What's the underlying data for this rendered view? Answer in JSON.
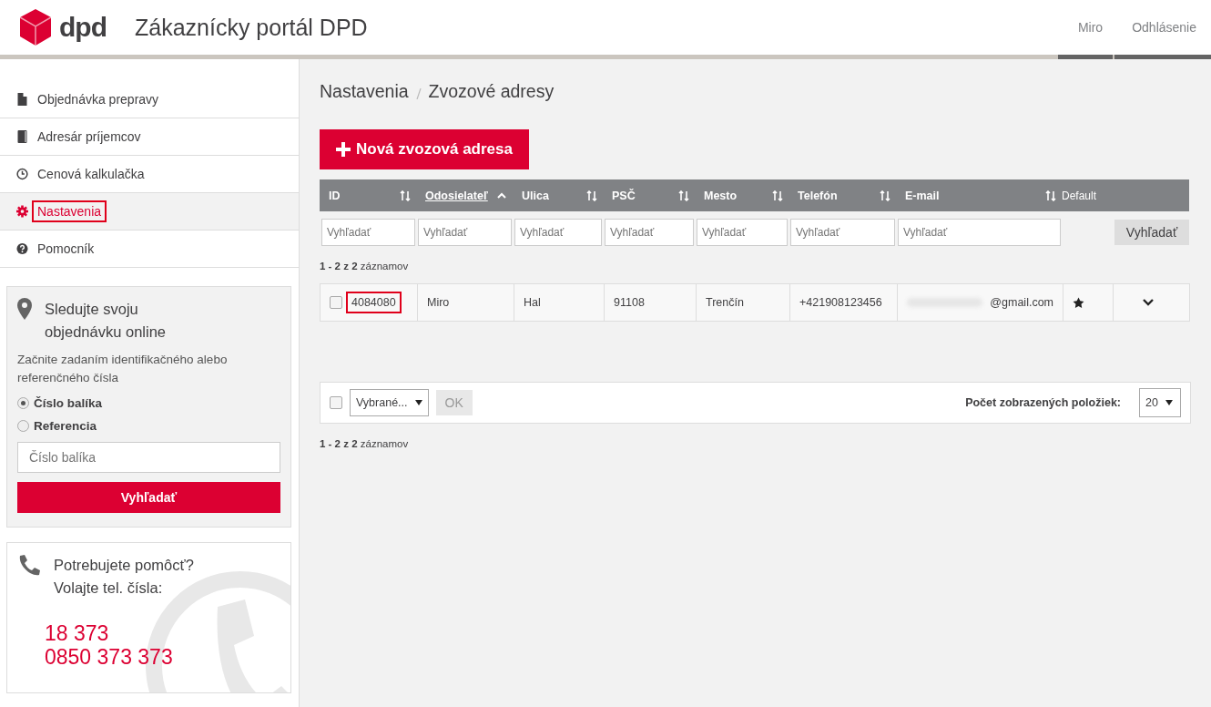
{
  "header": {
    "logo_text": "dpd",
    "title": "Zákaznícky portál DPD",
    "user_links": [
      {
        "label": "Miro"
      },
      {
        "label": "Odhlásenie"
      }
    ]
  },
  "sidebar": {
    "items": [
      {
        "label": "Objednávka prepravy",
        "kind": "document",
        "selected": false,
        "highlighted": false
      },
      {
        "label": "Adresár príjemcov",
        "kind": "book",
        "selected": false,
        "highlighted": false
      },
      {
        "label": "Cenová kalkulačka",
        "kind": "clock",
        "selected": false,
        "highlighted": false
      },
      {
        "label": "Nastavenia",
        "kind": "gear",
        "selected": true,
        "highlighted": true
      },
      {
        "label": "Pomocník",
        "kind": "question",
        "selected": false,
        "highlighted": false
      }
    ],
    "tracking": {
      "title_lines": [
        "Sledujte svoju",
        "objednávku online"
      ],
      "description": "Začnite zadaním identifikačného alebo referenčného čísla",
      "options": [
        {
          "label": "Číslo balíka",
          "selected": true
        },
        {
          "label": "Referencia",
          "selected": false
        }
      ],
      "placeholder": "Číslo balíka",
      "button": "Vyhľadať"
    },
    "help": {
      "title_lines": [
        "Potrebujete pomôcť?",
        "Volajte tel. čísla:"
      ],
      "phones": [
        "18 373",
        "0850 373 373"
      ]
    }
  },
  "breadcrumb": [
    "Nastavenia",
    "Zvozové adresy"
  ],
  "new_button": "Nová zvozová adresa",
  "table": {
    "columns": [
      {
        "label": "ID",
        "sortable": true,
        "sorted": false
      },
      {
        "label": "Odosielateľ",
        "sortable": true,
        "sorted": true
      },
      {
        "label": "Ulica",
        "sortable": true,
        "sorted": false
      },
      {
        "label": "PSČ",
        "sortable": true,
        "sorted": false
      },
      {
        "label": "Mesto",
        "sortable": true,
        "sorted": false
      },
      {
        "label": "Telefón",
        "sortable": true,
        "sorted": false
      },
      {
        "label": "E-mail",
        "sortable": true,
        "sorted": false
      },
      {
        "label": "Default",
        "sortable": false,
        "sorted": false
      }
    ],
    "filter_placeholders": [
      "Vyhľadať",
      "Vyhľadať",
      "Vyhľadať",
      "Vyhľadať",
      "Vyhľadať",
      "Vyhľadať",
      "Vyhľadať"
    ],
    "filter_button": "Vyhľadať",
    "record_count_top": "**1 - 2 z 2** záznamov",
    "rows": [
      {
        "checked": false,
        "id": "4084080",
        "id_highlighted": true,
        "sender": "Miro",
        "street": "Hal",
        "zip": "91108",
        "city": "Trenčín",
        "phone": "+421908123456",
        "email": "@gmail.com",
        "email_redacted": true,
        "default": true,
        "expanded": false
      }
    ]
  },
  "bulk_bar": {
    "checked": false,
    "action_select": "Vybrané...",
    "ok_button": "OK",
    "ok_disabled": true,
    "page_size_label": "Počet zobrazených položiek:",
    "page_size": "20"
  },
  "record_count_bottom": "**1 - 2 z 2** záznamov"
}
